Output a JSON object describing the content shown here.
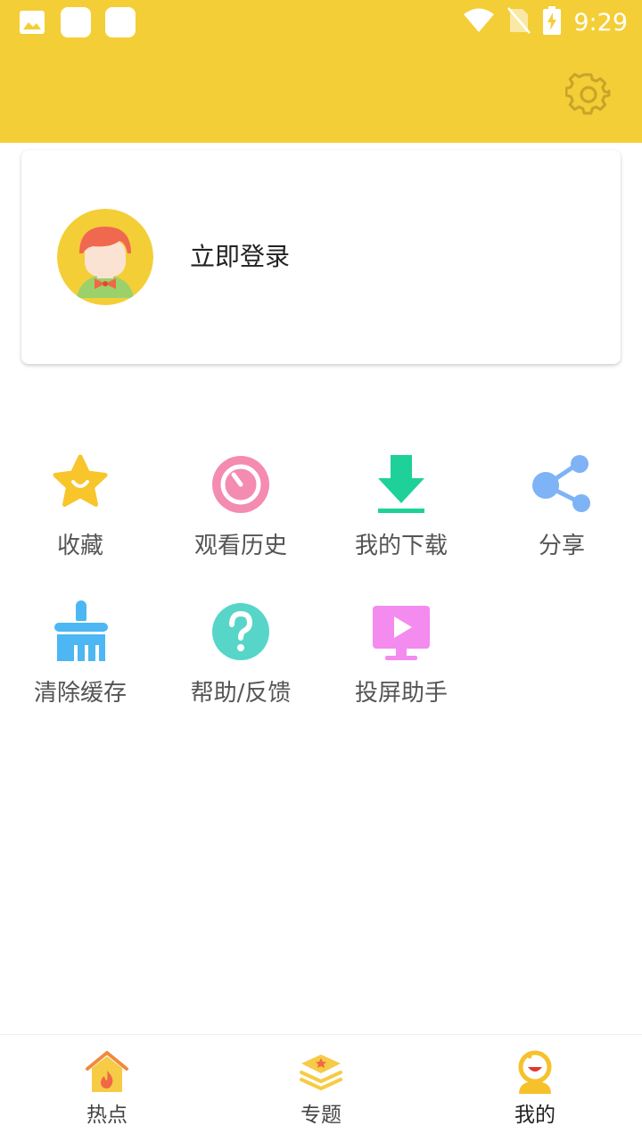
{
  "status_bar": {
    "time": "9:29",
    "left_icons": [
      "photo-icon",
      "notification-icon",
      "notification-icon"
    ],
    "right_icons": [
      "wifi-icon",
      "no-sim-icon",
      "battery-charging-icon"
    ]
  },
  "header": {
    "background_color": "#F4CE36",
    "settings_icon": "gear-icon"
  },
  "login_card": {
    "label": "立即登录",
    "avatar_icon": "user-avatar"
  },
  "menu": {
    "items": [
      {
        "label": "收藏",
        "icon": "star-icon",
        "color": "#F8C52B"
      },
      {
        "label": "观看历史",
        "icon": "history-timer-icon",
        "color": "#F48BB0"
      },
      {
        "label": "我的下载",
        "icon": "download-icon",
        "color": "#1ED199"
      },
      {
        "label": "分享",
        "icon": "share-icon",
        "color": "#7EB3F6"
      },
      {
        "label": "清除缓存",
        "icon": "broom-icon",
        "color": "#4CB7F2"
      },
      {
        "label": "帮助/反馈",
        "icon": "help-icon",
        "color": "#57D5C9"
      },
      {
        "label": "投屏助手",
        "icon": "screen-cast-icon",
        "color": "#F48BEF"
      }
    ]
  },
  "bottom_nav": {
    "items": [
      {
        "label": "热点",
        "icon": "home-fire-icon",
        "active": false
      },
      {
        "label": "专题",
        "icon": "layers-star-icon",
        "active": false
      },
      {
        "label": "我的",
        "icon": "profile-icon",
        "active": true
      }
    ]
  }
}
